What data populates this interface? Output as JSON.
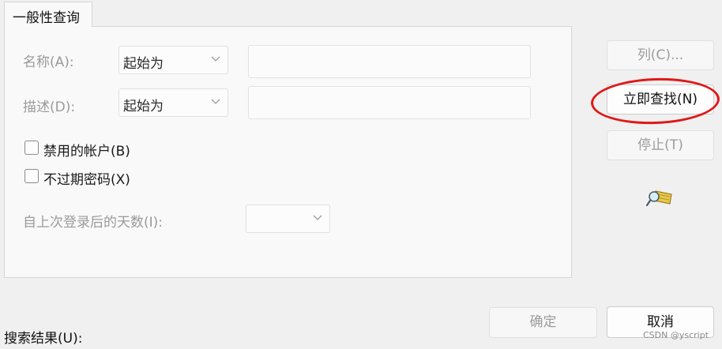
{
  "tab": {
    "label": "一般性查询"
  },
  "form": {
    "name": {
      "label": "名称(A):",
      "match": "起始为",
      "value": ""
    },
    "description": {
      "label": "描述(D):",
      "match": "起始为",
      "value": ""
    },
    "disabled_accounts": {
      "label": "禁用的帐户(B)",
      "checked": false
    },
    "non_expiring_password": {
      "label": "不过期密码(X)",
      "checked": false
    },
    "days_since_last_logon": {
      "label": "自上次登录后的天数(I):",
      "value": ""
    }
  },
  "buttons": {
    "columns": "列(C)...",
    "find_now": "立即查找(N)",
    "stop": "停止(T)",
    "ok": "确定",
    "cancel": "取消"
  },
  "results": {
    "label": "搜索结果(U):"
  },
  "watermark": "CSDN @yscript",
  "icons": {
    "chevron": "chevron-down-icon",
    "search": "search-flashlight-icon"
  },
  "colors": {
    "annotation": "#e01818",
    "disabled_text": "#9a9a9a"
  }
}
